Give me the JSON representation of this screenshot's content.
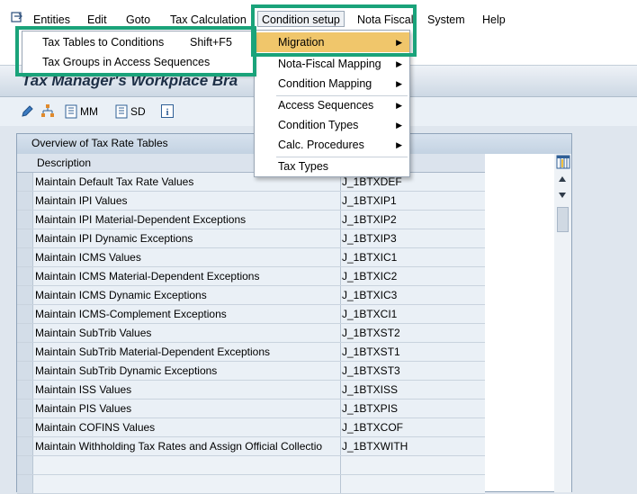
{
  "menubar": {
    "items": [
      "Entities",
      "Edit",
      "Goto",
      "Tax Calculation",
      "Condition setup",
      "Nota Fiscal",
      "System",
      "Help"
    ]
  },
  "title": "Tax Manager's Workplace Bra",
  "app_toolbar": {
    "mm_label": "MM",
    "sd_label": "SD"
  },
  "table": {
    "caption": "Overview of Tax Rate Tables",
    "header_description": "Description",
    "rows": [
      [
        "Maintain Default Tax Rate Values",
        "J_1BTXDEF"
      ],
      [
        "Maintain IPI Values",
        "J_1BTXIP1"
      ],
      [
        "Maintain IPI Material-Dependent Exceptions",
        "J_1BTXIP2"
      ],
      [
        "Maintain IPI Dynamic Exceptions",
        "J_1BTXIP3"
      ],
      [
        "Maintain ICMS Values",
        "J_1BTXIC1"
      ],
      [
        "Maintain ICMS Material-Dependent Exceptions",
        "J_1BTXIC2"
      ],
      [
        "Maintain ICMS Dynamic Exceptions",
        "J_1BTXIC3"
      ],
      [
        "Maintain ICMS-Complement Exceptions",
        "J_1BTXCI1"
      ],
      [
        "Maintain SubTrib Values",
        "J_1BTXST2"
      ],
      [
        "Maintain SubTrib Material-Dependent Exceptions",
        "J_1BTXST1"
      ],
      [
        "Maintain SubTrib Dynamic Exceptions",
        "J_1BTXST3"
      ],
      [
        "Maintain ISS Values",
        "J_1BTXISS"
      ],
      [
        "Maintain PIS Values",
        "J_1BTXPIS"
      ],
      [
        "Maintain COFINS Values",
        "J_1BTXCOF"
      ],
      [
        "Maintain Withholding Tax Rates and Assign Official Collectio",
        "J_1BTXWITH"
      ]
    ]
  },
  "condition_menu": {
    "items": [
      {
        "label": "Migration",
        "submenu": true
      },
      {
        "label": "Nota-Fiscal Mapping",
        "submenu": true
      },
      {
        "label": "Condition Mapping",
        "submenu": true
      },
      {
        "label": "Access Sequences",
        "submenu": true
      },
      {
        "label": "Condition Types",
        "submenu": true
      },
      {
        "label": "Calc. Procedures",
        "submenu": true
      },
      {
        "label": "Tax Types",
        "submenu": false
      }
    ]
  },
  "migration_submenu": {
    "items": [
      {
        "label": "Tax Tables to Conditions",
        "shortcut": "Shift+F5"
      },
      {
        "label": "Tax Groups in Access Sequences",
        "shortcut": ""
      }
    ]
  },
  "colors": {
    "highlight": "#1aa37a",
    "menu_active": "#f0c66b"
  }
}
